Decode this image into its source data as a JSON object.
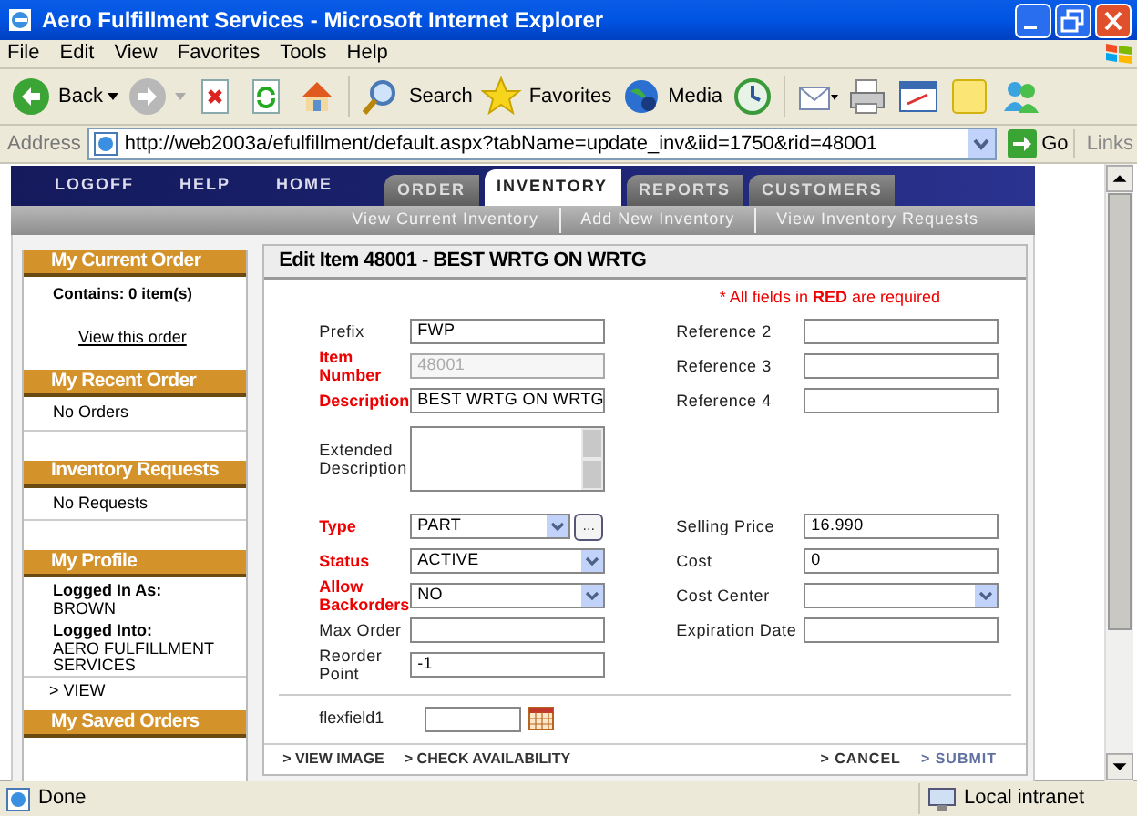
{
  "window": {
    "title": "Aero Fulfillment Services - Microsoft Internet Explorer"
  },
  "menu": [
    "File",
    "Edit",
    "View",
    "Favorites",
    "Tools",
    "Help"
  ],
  "toolbar": [
    {
      "kind": "back",
      "label": "Back"
    },
    {
      "kind": "forward"
    },
    {
      "kind": "stop"
    },
    {
      "kind": "refresh"
    },
    {
      "kind": "home"
    },
    {
      "kind": "search",
      "label": "Search"
    },
    {
      "kind": "favorites",
      "label": "Favorites"
    },
    {
      "kind": "media",
      "label": "Media"
    },
    {
      "kind": "history"
    },
    {
      "kind": "mail"
    },
    {
      "kind": "print"
    },
    {
      "kind": "edit"
    },
    {
      "kind": "notes"
    },
    {
      "kind": "messenger"
    }
  ],
  "address_bar": {
    "label": "Address",
    "url": "http://web2003a/efulfillment/default.aspx?tabName=update_inv&iid=1750&rid=48001",
    "go": "Go",
    "links": "Links"
  },
  "nav": {
    "links": [
      "LOGOFF",
      "HELP",
      "HOME"
    ],
    "tabs": [
      {
        "label": "ORDER",
        "selected": false
      },
      {
        "label": "INVENTORY",
        "selected": true
      },
      {
        "label": "REPORTS",
        "selected": false
      },
      {
        "label": "CUSTOMERS",
        "selected": false
      }
    ],
    "subnav": [
      "View Current Inventory",
      "Add New Inventory",
      "View Inventory Requests"
    ]
  },
  "sidebar": [
    {
      "title": "My Current Order",
      "lines": [
        {
          "kind": "bold",
          "text": "Contains: 0 item(s)"
        },
        {
          "kind": "link",
          "text": "View this order"
        }
      ]
    },
    {
      "title": "My Recent Order",
      "lines": [
        {
          "kind": "plain",
          "text": "No Orders"
        }
      ]
    },
    {
      "title": "Inventory Requests",
      "lines": [
        {
          "kind": "plain",
          "text": "No Requests"
        }
      ]
    },
    {
      "title": "My Profile",
      "lines": [
        {
          "kind": "bold",
          "text": "Logged In As:"
        },
        {
          "kind": "plain",
          "text": "BROWN"
        },
        {
          "kind": "bold",
          "text": "Logged Into:"
        },
        {
          "kind": "plain",
          "text": "AERO FULFILLMENT SERVICES"
        },
        {
          "kind": "action",
          "text": "> VIEW"
        }
      ]
    },
    {
      "title": "My Saved Orders"
    }
  ],
  "form": {
    "title": "Edit Item 48001 - BEST WRTG ON WRTG",
    "required_note": "* All fields in **RED** are required",
    "rows": [
      {
        "left": {
          "label": "Prefix",
          "required": false,
          "kind": "text",
          "value": "FWP"
        },
        "right": {
          "label": "Reference 2",
          "required": false,
          "kind": "text"
        }
      },
      {
        "left": {
          "label": "Item Number",
          "required": true,
          "kind": "text",
          "value": "48001",
          "disabled": true
        },
        "right": {
          "label": "Reference 3",
          "required": false,
          "kind": "text"
        }
      },
      {
        "left": {
          "label": "Description",
          "required": true,
          "kind": "text",
          "value": "BEST WRTG ON WRTG"
        },
        "right": {
          "label": "Reference 4",
          "required": false,
          "kind": "text"
        }
      },
      {
        "left": {
          "label": "Extended Description",
          "required": false,
          "kind": "textarea"
        }
      },
      {
        "left": {
          "label": "Type",
          "required": true,
          "kind": "select",
          "value": "PART",
          "lookup": "..."
        },
        "right": {
          "label": "Selling Price",
          "required": false,
          "kind": "text",
          "value": "16.990"
        }
      },
      {
        "left": {
          "label": "Status",
          "required": true,
          "kind": "select",
          "value": "ACTIVE"
        },
        "right": {
          "label": "Cost",
          "required": false,
          "kind": "text",
          "value": "0"
        }
      },
      {
        "left": {
          "label": "Allow Backorders",
          "required": true,
          "kind": "select",
          "value": "NO"
        },
        "right": {
          "label": "Cost Center",
          "required": false,
          "kind": "select"
        }
      },
      {
        "left": {
          "label": "Max Order",
          "required": false,
          "kind": "text"
        },
        "right": {
          "label": "Expiration Date",
          "required": false,
          "kind": "text"
        }
      },
      {
        "left": {
          "label": "Reorder Point",
          "required": false,
          "kind": "text",
          "value": "-1"
        }
      }
    ],
    "flexfield": {
      "label": "flexfield1"
    },
    "actions_left": [
      "> VIEW IMAGE",
      "> CHECK AVAILABILITY"
    ],
    "actions_right": [
      "> CANCEL",
      "> SUBMIT"
    ]
  },
  "status_bar": {
    "text": "Done",
    "zone": "Local intranet"
  }
}
